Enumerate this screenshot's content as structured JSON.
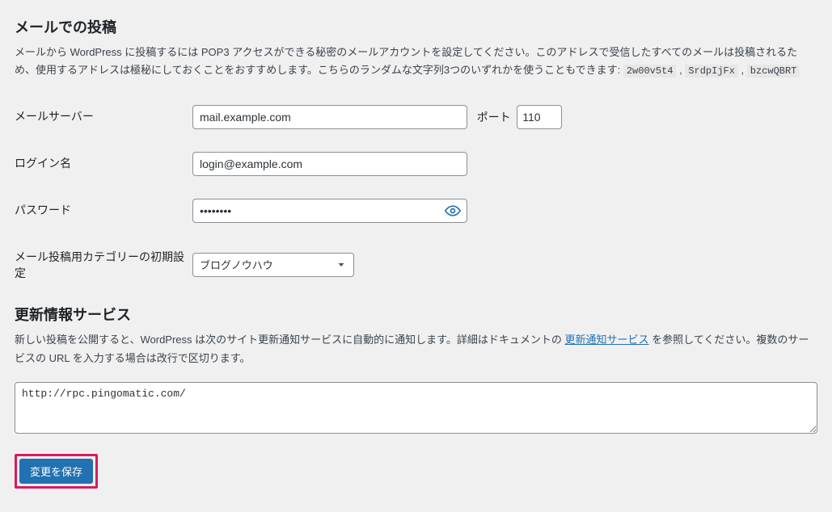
{
  "mail": {
    "heading": "メールでの投稿",
    "desc_pre": "メールから WordPress に投稿するには POP3 アクセスができる秘密のメールアカウントを設定してください。このアドレスで受信したすべてのメールは投稿されるため、使用するアドレスは極秘にしておくことをおすすめします。こちらのランダムな文字列3つのいずれかを使うこともできます: ",
    "keys": [
      "2w00v5t4",
      "SrdpIjFx",
      "bzcwQBRT"
    ],
    "server_label": "メールサーバー",
    "server_value": "mail.example.com",
    "port_label": "ポート",
    "port_value": "110",
    "login_label": "ログイン名",
    "login_value": "login@example.com",
    "password_label": "パスワード",
    "password_value": "••••••••",
    "category_label": "メール投稿用カテゴリーの初期設定",
    "category_value": "ブログノウハウ"
  },
  "update": {
    "heading": "更新情報サービス",
    "desc_pre": "新しい投稿を公開すると、WordPress は次のサイト更新通知サービスに自動的に通知します。詳細はドキュメントの ",
    "desc_link": "更新通知サービス",
    "desc_post": " を参照してください。複数のサービスの URL を入力する場合は改行で区切ります。",
    "textarea_value": "http://rpc.pingomatic.com/"
  },
  "submit": {
    "button_label": "変更を保存"
  }
}
